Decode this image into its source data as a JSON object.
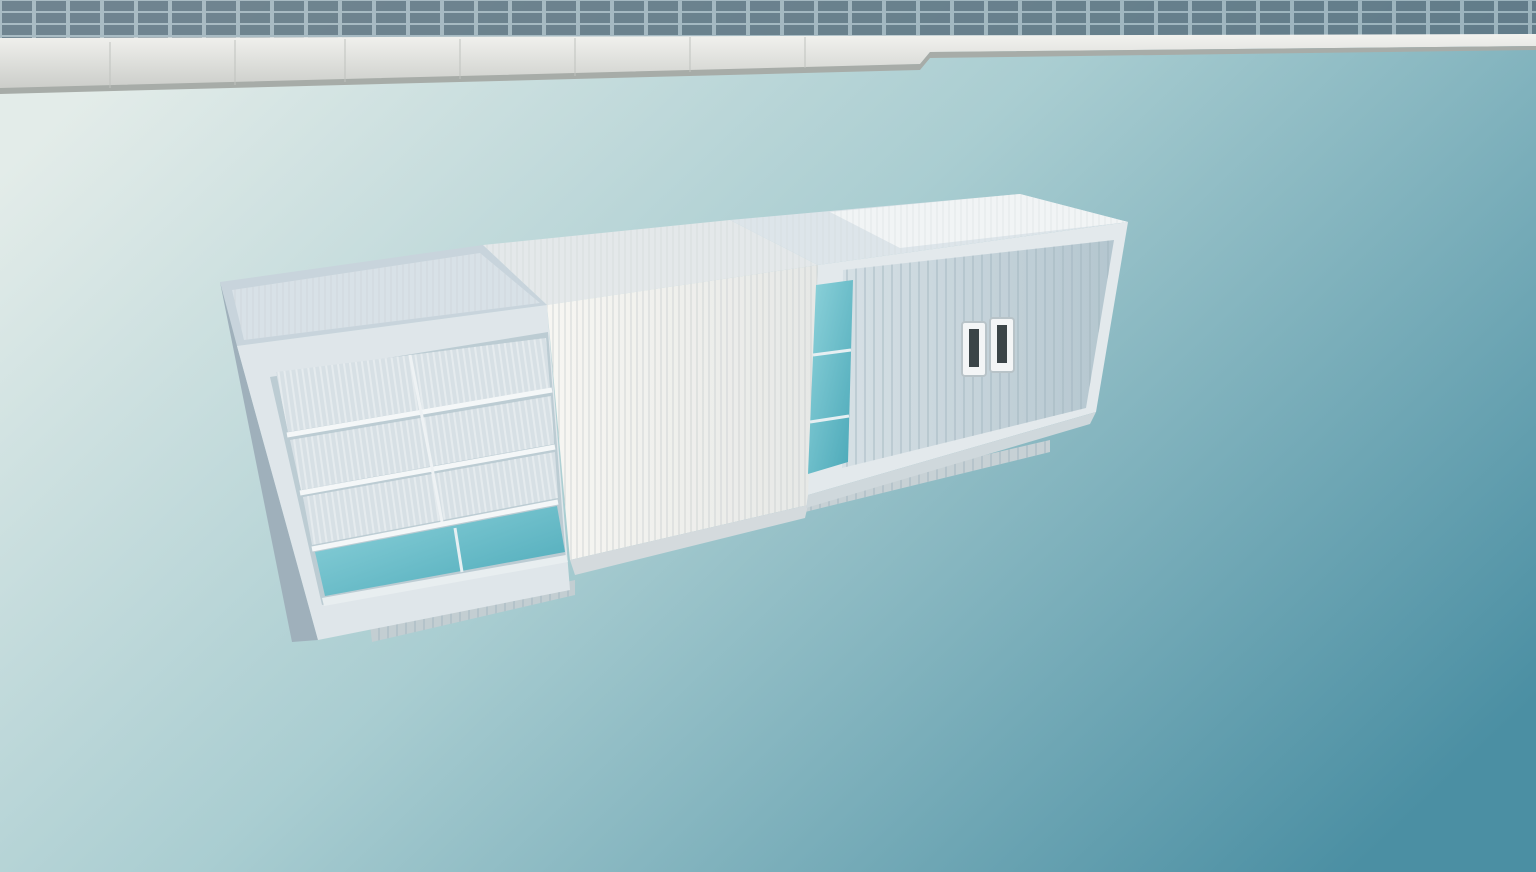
{
  "image": {
    "kind": "photograph",
    "subject": "modular-building-unit",
    "palette": {
      "sky_light": "#e3ece9",
      "sky_mid": "#9dc6cc",
      "sky_dark": "#4f93a5",
      "panel_white": "#eef2f2",
      "panel_shadow": "#b9c8cd",
      "glass": "#6fc3cf",
      "trim": "#d5dde0"
    }
  }
}
